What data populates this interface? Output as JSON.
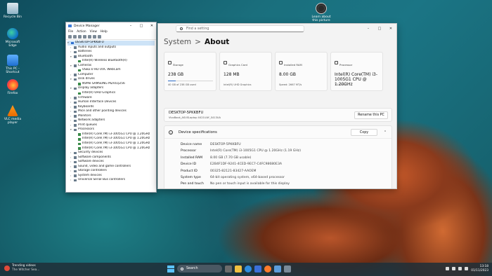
{
  "desktop": {
    "icons": [
      {
        "label": "Recycle Bin"
      },
      {
        "label": "Microsoft Edge"
      },
      {
        "label": "This PC - Shortcut"
      },
      {
        "label": "Firefox"
      },
      {
        "label": "VLC media player"
      },
      {
        "label": "Learn about this picture"
      }
    ]
  },
  "device_manager": {
    "title": "Device Manager",
    "menu": [
      "File",
      "Action",
      "View",
      "Help"
    ],
    "root": "DESKTOP-5PKKBFU",
    "tree": [
      {
        "label": "Audio inputs and outputs",
        "level": 1,
        "expanded": false
      },
      {
        "label": "Batteries",
        "level": 1,
        "expanded": false
      },
      {
        "label": "Bluetooth",
        "level": 1,
        "expanded": true
      },
      {
        "label": "Intel(R) Wireless Bluetooth(R)",
        "level": 2
      },
      {
        "label": "Cameras",
        "level": 1,
        "expanded": true
      },
      {
        "label": "USB2.0 HD UVC WebCam",
        "level": 2
      },
      {
        "label": "Computer",
        "level": 1,
        "expanded": false
      },
      {
        "label": "Disk drives",
        "level": 1,
        "expanded": true
      },
      {
        "label": "NVMe SAMSUNG MZVLQ256",
        "level": 2
      },
      {
        "label": "Display adapters",
        "level": 1,
        "expanded": true
      },
      {
        "label": "Intel(R) UHD Graphics",
        "level": 2
      },
      {
        "label": "Firmware",
        "level": 1,
        "expanded": false
      },
      {
        "label": "Human Interface Devices",
        "level": 1,
        "expanded": false
      },
      {
        "label": "Keyboards",
        "level": 1,
        "expanded": false
      },
      {
        "label": "Mice and other pointing devices",
        "level": 1,
        "expanded": false
      },
      {
        "label": "Monitors",
        "level": 1,
        "expanded": false
      },
      {
        "label": "Network adapters",
        "level": 1,
        "expanded": false
      },
      {
        "label": "Print queues",
        "level": 1,
        "expanded": false
      },
      {
        "label": "Processors",
        "level": 1,
        "expanded": true
      },
      {
        "label": "Intel(R) Core(TM) i3-1005G1 CPU @ 1.20GHz",
        "level": 2
      },
      {
        "label": "Intel(R) Core(TM) i3-1005G1 CPU @ 1.20GHz",
        "level": 2
      },
      {
        "label": "Intel(R) Core(TM) i3-1005G1 CPU @ 1.20GHz",
        "level": 2
      },
      {
        "label": "Intel(R) Core(TM) i3-1005G1 CPU @ 1.20GHz",
        "level": 2
      },
      {
        "label": "Security devices",
        "level": 1,
        "expanded": false
      },
      {
        "label": "Software components",
        "level": 1,
        "expanded": false
      },
      {
        "label": "Software devices",
        "level": 1,
        "expanded": false
      },
      {
        "label": "Sound, video and game controllers",
        "level": 1,
        "expanded": false
      },
      {
        "label": "Storage controllers",
        "level": 1,
        "expanded": false
      },
      {
        "label": "System devices",
        "level": 1,
        "expanded": false
      },
      {
        "label": "Universal Serial Bus controllers",
        "level": 1,
        "expanded": false
      }
    ]
  },
  "settings": {
    "search_placeholder": "Find a setting",
    "breadcrumb_parent": "System",
    "breadcrumb_sep": ">",
    "breadcrumb_current": "About",
    "cards": [
      {
        "label": "Storage",
        "value": "238 GB",
        "sub": "40 GB of 238 GB used",
        "usage": 0.17
      },
      {
        "label": "Graphics Card",
        "value": "128 MB",
        "sub": "Intel(R) UHD Graphics"
      },
      {
        "label": "Installed RAM",
        "value": "8.00 GB",
        "sub": "Speed: 2667 MT/s"
      },
      {
        "label": "Processor",
        "value": "Intel(R) Core(TM) i3-1005G1 CPU @ 1.20GHz",
        "sub": "1.19 GHz"
      }
    ],
    "device_name": "DESKTOP-5PKKBFU",
    "device_model": "VivoBook_ASUSLaptop X421UAY_S413UA",
    "rename_label": "Rename this PC",
    "specs_title": "Device specifications",
    "copy_label": "Copy",
    "specs": [
      {
        "key": "Device name",
        "value": "DESKTOP-5PKKBFU"
      },
      {
        "key": "Processor",
        "value": "Intel(R) Core(TM) i3-1005G1 CPU @ 1.20GHz (1.19 GHz)"
      },
      {
        "key": "Installed RAM",
        "value": "8.00 GB (7.70 GB usable)"
      },
      {
        "key": "Device ID",
        "value": "E2B4F1DF-9241-4CED-9EC7-C4FC98680E3A"
      },
      {
        "key": "Product ID",
        "value": "00325-82121-83427-AAOEM"
      },
      {
        "key": "System type",
        "value": "64-bit operating system, x64-based processor"
      },
      {
        "key": "Pen and touch",
        "value": "No pen or touch input is available for this display"
      }
    ]
  },
  "taskbar": {
    "news_title": "Trending videos",
    "news_sub": "The Witcher Sea...",
    "search_label": "Search",
    "time": "13:18",
    "date": "01/11/2023",
    "colors": {
      "accent": "#5cc3ff"
    }
  }
}
